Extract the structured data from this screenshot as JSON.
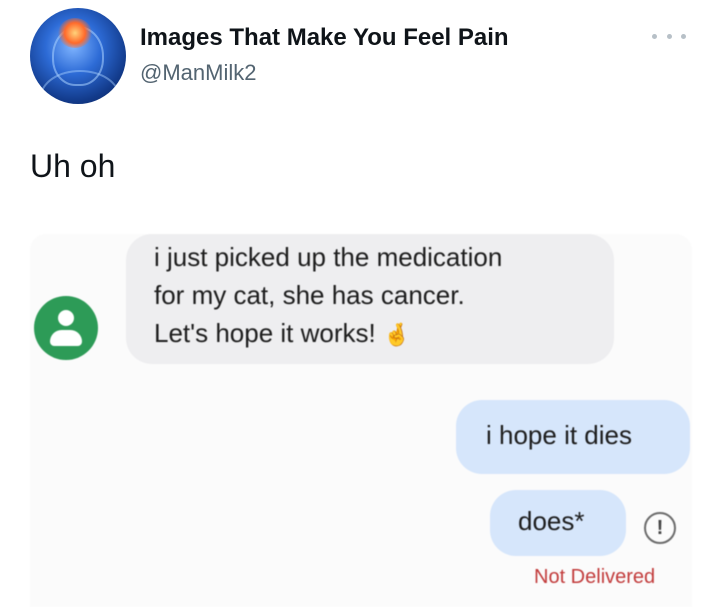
{
  "tweet": {
    "author": {
      "display_name": "Images That Make You Feel Pain",
      "handle": "@ManMilk2",
      "avatar_icon": "glowing-head-avatar"
    },
    "more_icon": "more-dots-icon",
    "text": "Uh oh"
  },
  "screenshot": {
    "contact_avatar_icon": "person-icon",
    "received_message": {
      "lines": [
        "i just picked up the medication",
        "for my cat, she has cancer.",
        "Let's hope it works!"
      ],
      "emoji": "🤞"
    },
    "sent_messages": [
      "i hope it dies",
      "does*"
    ],
    "error_icon_glyph": "!",
    "status": "Not Delivered"
  },
  "colors": {
    "received_bubble": "#eeeef0",
    "sent_bubble": "#d6e6fb",
    "contact_avatar": "#2d9b57",
    "status_red": "#c23b3b"
  }
}
